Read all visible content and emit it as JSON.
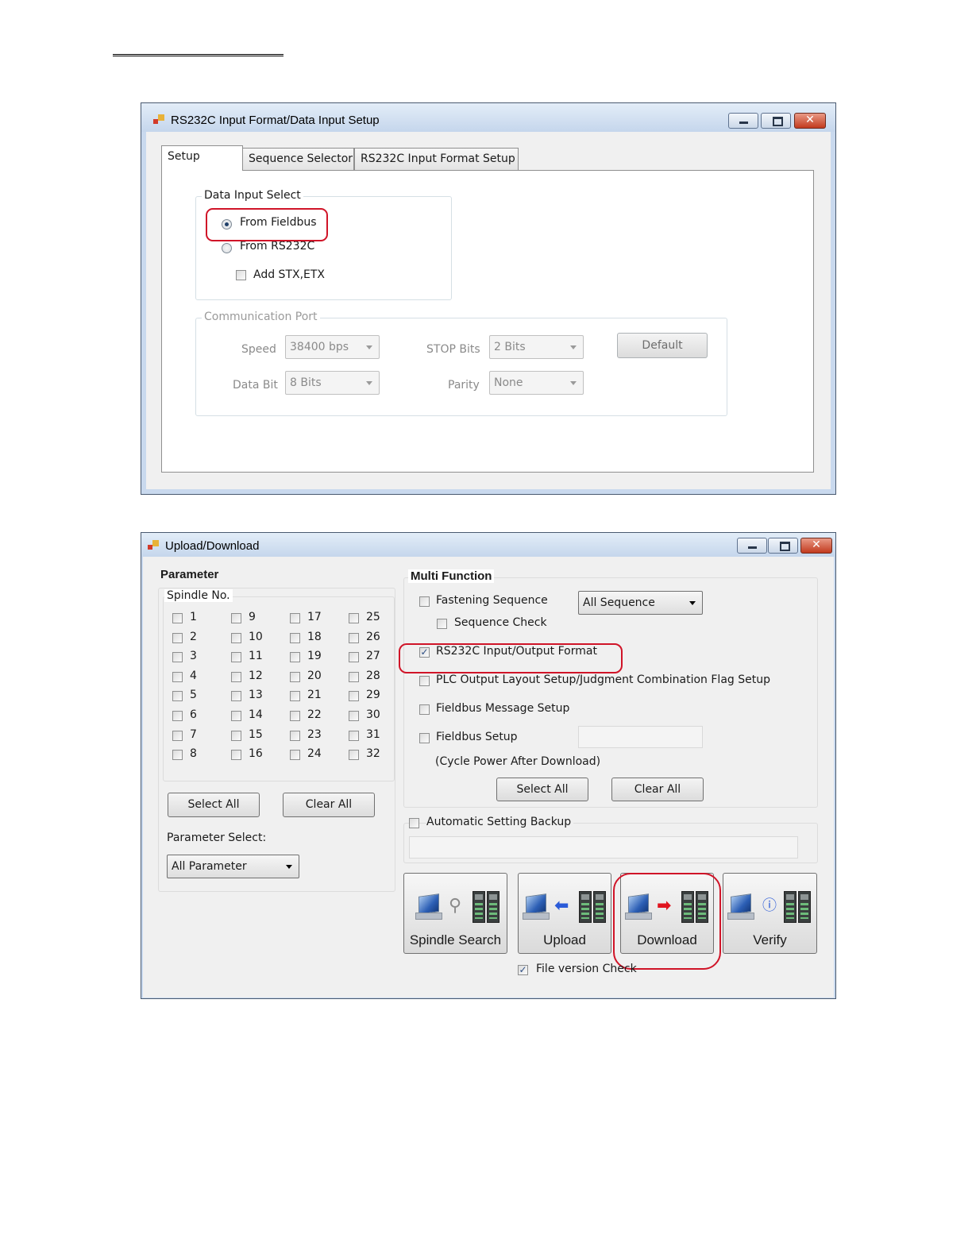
{
  "setup_window": {
    "title": "RS232C Input Format/Data Input Setup",
    "controls": {
      "close": "✕"
    },
    "tabs": [
      "Setup",
      "Sequence Selector",
      "RS232C Input Format Setup"
    ],
    "data_input_select": {
      "label": "Data Input Select",
      "from_fieldbus": "From Fieldbus",
      "from_rs232c": "From RS232C",
      "add_stx_etx": "Add STX,ETX",
      "selected": "From Fieldbus"
    },
    "communication_port": {
      "label": "Communication Port",
      "speed_label": "Speed",
      "speed_value": "38400 bps",
      "data_bit_label": "Data Bit",
      "data_bit_value": "8 Bits",
      "stop_bits_label": "STOP Bits",
      "stop_bits_value": "2 Bits",
      "parity_label": "Parity",
      "parity_value": "None",
      "default_button": "Default"
    }
  },
  "updown_window": {
    "title": "Upload/Download",
    "controls": {
      "close": "✕"
    },
    "parameter": {
      "heading": "Parameter",
      "spindle_label": "Spindle No.",
      "spindles": [
        [
          "1",
          "2",
          "3",
          "4",
          "5",
          "6",
          "7",
          "8"
        ],
        [
          "9",
          "10",
          "11",
          "12",
          "13",
          "14",
          "15",
          "16"
        ],
        [
          "17",
          "18",
          "19",
          "20",
          "21",
          "22",
          "23",
          "24"
        ],
        [
          "25",
          "26",
          "27",
          "28",
          "29",
          "30",
          "31",
          "32"
        ]
      ],
      "select_all": "Select All",
      "clear_all": "Clear All",
      "parameter_select_label": "Parameter Select:",
      "parameter_select_value": "All Parameter"
    },
    "multi_function": {
      "heading": "Multi Function",
      "fastening_sequence": "Fastening Sequence",
      "sequence_combo": "All Sequence",
      "sequence_check": "Sequence Check",
      "rs232c_format": "RS232C Input/Output Format",
      "rs232c_format_checked": true,
      "plc_output": "PLC Output Layout Setup/Judgment Combination Flag Setup",
      "fieldbus_message": "Fieldbus Message Setup",
      "fieldbus_setup": "Fieldbus Setup",
      "cycle_note": "(Cycle Power After Download)",
      "select_all": "Select All",
      "clear_all": "Clear All"
    },
    "automatic_backup": "Automatic Setting Backup",
    "actions": [
      {
        "label": "Spindle Search",
        "icon": "magnifier-icon"
      },
      {
        "label": "Upload",
        "icon": "arrow-left-icon"
      },
      {
        "label": "Download",
        "icon": "arrow-right-icon"
      },
      {
        "label": "Verify",
        "icon": "info-icon"
      }
    ],
    "file_version_check": "File version Check",
    "file_version_checked": true
  },
  "colors": {
    "callout": "#d01428",
    "upload_arrow": "#2b5bd8",
    "download_arrow": "#e0141e"
  }
}
